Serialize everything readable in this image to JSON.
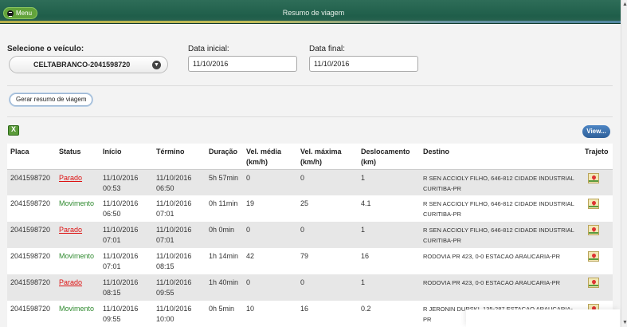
{
  "header": {
    "menu_label": "Menu",
    "title": "Resumo de viagem"
  },
  "form": {
    "vehicle_label": "Selecione o veículo:",
    "vehicle_value": "CELTABRANCO-2041598720",
    "start_label": "Data inicial:",
    "start_value": "11/10/2016",
    "end_label": "Data final:",
    "end_value": "11/10/2016",
    "generate_label": "Gerar resumo de viagem"
  },
  "toolbar": {
    "view_label": "View..."
  },
  "table": {
    "headers": {
      "placa": "Placa",
      "status": "Status",
      "inicio": "Início",
      "termino": "Término",
      "duracao": "Duração",
      "vel_media": "Vel. média (km/h)",
      "vel_maxima": "Vel. máxima (km/h)",
      "deslocamento": "Deslocamento (km)",
      "destino": "Destino",
      "trajeto": "Trajeto"
    },
    "rows": [
      {
        "placa": "2041598720",
        "status": "Parado",
        "inicio": "11/10/2016 00:53",
        "termino": "11/10/2016 06:50",
        "duracao": "5h 57min",
        "vel_media": "0",
        "vel_maxima": "0",
        "deslocamento": "1",
        "destino": "R SEN ACCIOLY FILHO, 646-812 CIDADE INDUSTRIAL CURITIBA-PR"
      },
      {
        "placa": "2041598720",
        "status": "Movimento",
        "inicio": "11/10/2016 06:50",
        "termino": "11/10/2016 07:01",
        "duracao": "0h 11min",
        "vel_media": "19",
        "vel_maxima": "25",
        "deslocamento": "4.1",
        "destino": "R SEN ACCIOLY FILHO, 646-812 CIDADE INDUSTRIAL CURITIBA-PR"
      },
      {
        "placa": "2041598720",
        "status": "Parado",
        "inicio": "11/10/2016 07:01",
        "termino": "11/10/2016 07:01",
        "duracao": "0h 0min",
        "vel_media": "0",
        "vel_maxima": "0",
        "deslocamento": "1",
        "destino": "R SEN ACCIOLY FILHO, 646-812 CIDADE INDUSTRIAL CURITIBA-PR"
      },
      {
        "placa": "2041598720",
        "status": "Movimento",
        "inicio": "11/10/2016 07:01",
        "termino": "11/10/2016 08:15",
        "duracao": "1h 14min",
        "vel_media": "42",
        "vel_maxima": "79",
        "deslocamento": "16",
        "destino": "RODOVIA PR 423, 0-0 ESTACAO ARAUCARIA-PR"
      },
      {
        "placa": "2041598720",
        "status": "Parado",
        "inicio": "11/10/2016 08:15",
        "termino": "11/10/2016 09:55",
        "duracao": "1h 40min",
        "vel_media": "0",
        "vel_maxima": "0",
        "deslocamento": "1",
        "destino": "RODOVIA PR 423, 0-0 ESTACAO ARAUCARIA-PR"
      },
      {
        "placa": "2041598720",
        "status": "Movimento",
        "inicio": "11/10/2016 09:55",
        "termino": "11/10/2016 10:00",
        "duracao": "0h 5min",
        "vel_media": "10",
        "vel_maxima": "16",
        "deslocamento": "0.2",
        "destino": "R JERONIN DURSKI, 135-287 ESTACAO ARAUCARIA-PR"
      }
    ]
  },
  "colors": {
    "header_bg": "#1f5e4a",
    "parado": "#dd1111",
    "movimento": "#2f8a2f",
    "view_btn": "#3a6fae"
  }
}
